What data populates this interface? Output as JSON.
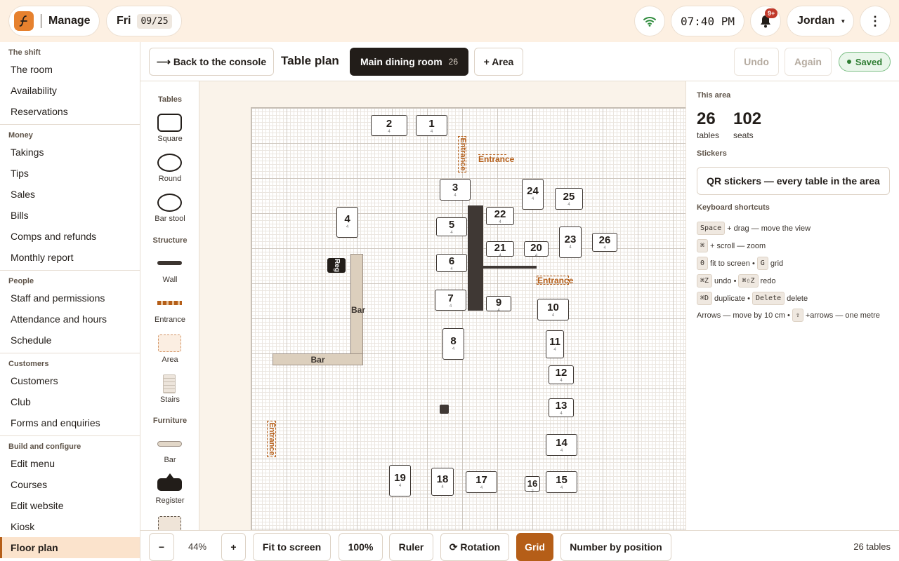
{
  "app": {
    "name": "Manage",
    "day": "Fri",
    "date": "09/25",
    "time": "07:40 PM",
    "notifications": "9+",
    "user": "Jordan"
  },
  "sidebar": {
    "sections": [
      {
        "title": "The shift",
        "items": [
          "The room",
          "Availability",
          "Reservations"
        ]
      },
      {
        "title": "Money",
        "items": [
          "Takings",
          "Tips",
          "Sales",
          "Bills",
          "Comps and refunds",
          "Monthly report"
        ]
      },
      {
        "title": "People",
        "items": [
          "Staff and permissions",
          "Attendance and hours",
          "Schedule"
        ]
      },
      {
        "title": "Customers",
        "items": [
          "Customers",
          "Club",
          "Forms and enquiries"
        ]
      },
      {
        "title": "Build and configure",
        "items": [
          "Edit menu",
          "Courses",
          "Edit website",
          "Kiosk",
          "Floor plan"
        ]
      }
    ],
    "active": "Floor plan"
  },
  "toolbar": {
    "back": "⟶ Back to the console",
    "title": "Table plan",
    "room": "Main dining room",
    "room_count": "26",
    "add_area": "+ Area",
    "undo": "Undo",
    "again": "Again",
    "saved": "Saved"
  },
  "palette": {
    "tables_head": "Tables",
    "square": "Square",
    "round": "Round",
    "bar_stool": "Bar stool",
    "structure_head": "Structure",
    "wall": "Wall",
    "entrance": "Entrance",
    "area": "Area",
    "stairs": "Stairs",
    "furniture_head": "Furniture",
    "bar": "Bar",
    "register": "Register"
  },
  "canvas": {
    "tables": [
      {
        "label": "2",
        "seats": "4"
      },
      {
        "label": "1",
        "seats": "4"
      },
      {
        "label": "3",
        "seats": "4"
      },
      {
        "label": "24",
        "seats": "4"
      },
      {
        "label": "25",
        "seats": "4"
      },
      {
        "label": "4",
        "seats": "4"
      },
      {
        "label": "22",
        "seats": "4"
      },
      {
        "label": "5",
        "seats": "4"
      },
      {
        "label": "23",
        "seats": "4"
      },
      {
        "label": "26",
        "seats": "4"
      },
      {
        "label": "21",
        "seats": "4"
      },
      {
        "label": "20",
        "seats": "4"
      },
      {
        "label": "6",
        "seats": "4"
      },
      {
        "label": "7",
        "seats": "4"
      },
      {
        "label": "9",
        "seats": "4"
      },
      {
        "label": "10",
        "seats": "4"
      },
      {
        "label": "8",
        "seats": "4"
      },
      {
        "label": "11",
        "seats": "4"
      },
      {
        "label": "12",
        "seats": "4"
      },
      {
        "label": "13",
        "seats": "4"
      },
      {
        "label": "14",
        "seats": "4"
      },
      {
        "label": "19",
        "seats": "4"
      },
      {
        "label": "18",
        "seats": "4"
      },
      {
        "label": "17",
        "seats": "4"
      },
      {
        "label": "16",
        "seats": "2"
      },
      {
        "label": "15",
        "seats": "4"
      }
    ],
    "entrance_label": "Entrance",
    "bar_label": "Bar",
    "register_label": "Reg"
  },
  "right_panel": {
    "area_head": "This area",
    "tables_count": "26",
    "tables_label": "tables",
    "seats_count": "102",
    "seats_label": "seats",
    "stickers_head": "Stickers",
    "qr_button": "QR stickers — every table in the area",
    "shortcuts_head": "Keyboard shortcuts",
    "shortcuts": [
      {
        "key": "Space",
        "text": "+ drag — move the view"
      },
      {
        "key": "⌘",
        "text": "+ scroll — zoom"
      },
      {
        "key": "0",
        "text": "fit to screen •",
        "key2": "G",
        "text2": "grid"
      },
      {
        "key": "⌘Z",
        "text": "undo •",
        "key2": "⌘⇧Z",
        "text2": "redo"
      },
      {
        "key": "⌘D",
        "text": "duplicate •",
        "key2": "Delete",
        "text2": "delete"
      },
      {
        "pre": "Arrows — move by 10 cm •",
        "key": "⇧",
        "text": "+arrows — one metre"
      }
    ]
  },
  "bottombar": {
    "zoom_out": "−",
    "zoom": "44%",
    "zoom_in": "+",
    "fit": "Fit to screen",
    "hundred": "100%",
    "ruler": "Ruler",
    "rotation": "⟳ Rotation",
    "grid": "Grid",
    "number": "Number by position",
    "count": "26 tables"
  },
  "colors": {
    "accent": "#b55e18",
    "active_bg": "#fbe3cc",
    "saved_green": "#2e7d32",
    "dark_pill": "#221d19"
  }
}
